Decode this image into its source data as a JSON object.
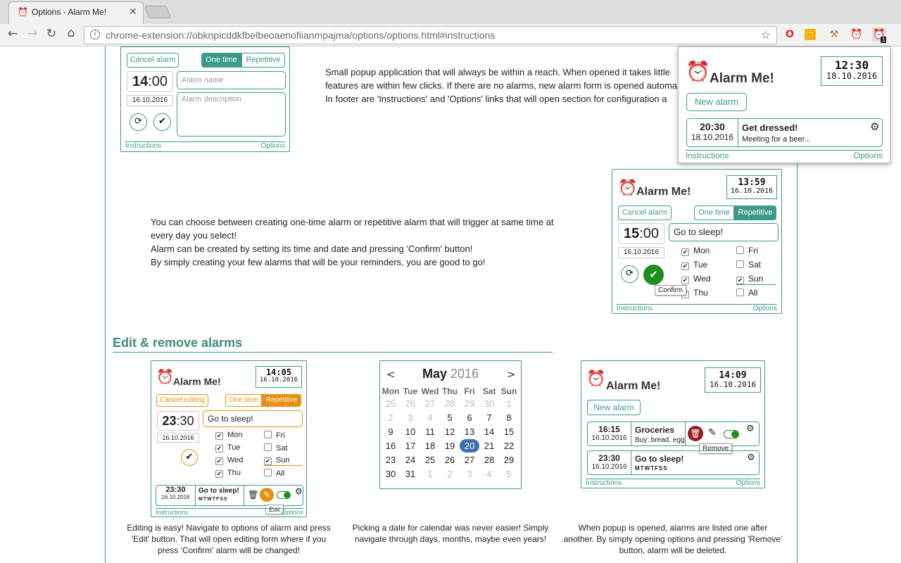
{
  "browser": {
    "tab_title": "Options - Alarm Me!",
    "url": "chrome-extension://obknpicddkfbelbeoaenofiianmpajma/options/options.html#instructions",
    "ext_badge": "1"
  },
  "section1": {
    "text": [
      "Small popup application that will always be within a reach. When opened it takes little",
      "features are within few clicks. If there are no alarms, new alarm form is opened automa",
      "In footer are 'Instructions' and 'Options' links that will open section for configuration a"
    ],
    "demo": {
      "cancel": "Cancel alarm",
      "one_time": "One time",
      "repetitive": "Repetitive",
      "hour": "14",
      "min": ":00",
      "date": "16.10.2016",
      "name_ph": "Alarm name",
      "desc_ph": "Alarm description",
      "instructions": "Instructions",
      "options": "Options"
    }
  },
  "popup": {
    "logo": "Alarm Me!",
    "time": "12:30",
    "date": "18.10.2016",
    "new_alarm": "New alarm",
    "alarm": {
      "time": "20:30",
      "date": "18.10.2016",
      "title": "Get dressed!",
      "desc": "Meeting for a beer..."
    },
    "instructions": "Instructions",
    "options": "Options"
  },
  "section2": {
    "text": [
      "You can choose between creating one-time alarm or repetitive alarm that will trigger at same time at",
      "every day you select!",
      "Alarm can be created by setting its time and date and pressing 'Confirm' button!",
      "By simply creating your few alarms that will be your reminders, you are good to go!"
    ],
    "demo": {
      "logo": "Alarm Me!",
      "time": "13:59",
      "date": "16.10.2016",
      "cancel": "Cancel alarm",
      "one_time": "One time",
      "repetitive": "Repetitive",
      "hour": "15",
      "min": ":00",
      "adate": "16.10.2016",
      "name": "Go to sleep!",
      "days": [
        "Mon",
        "Tue",
        "Wed",
        "Thu",
        "Fri",
        "Sat",
        "Sun",
        "All"
      ],
      "tooltip": "Confirm",
      "instructions": "Instructions",
      "options": "Options"
    }
  },
  "heading": "Edit & remove alarms",
  "edit_demo": {
    "logo": "Alarm Me!",
    "time": "14:05",
    "date": "16.10.2016",
    "cancel": "Cancel editing",
    "one_time": "One time",
    "repetitive": "Repetitive",
    "hour": "23",
    "min": ":30",
    "adate": "16.10.2016",
    "name": "Go to sleep!",
    "days": [
      "Mon",
      "Tue",
      "Wed",
      "Thu",
      "Fri",
      "Sat",
      "Sun",
      "All"
    ],
    "alarm_time": "23:30",
    "alarm_date": "16.10.2016",
    "alarm_title": "Go to sleep!",
    "alarm_days": "MTWTFSS",
    "tooltip": "Edit",
    "instructions": "Instructions",
    "options": "Options",
    "caption": [
      "Editing is easy! Navigate to options of alarm and press",
      "'Edit' button. That will open editing form where if you",
      "press 'Confirm' alarm will be changed!"
    ]
  },
  "calendar": {
    "month": "May",
    "year": "2016",
    "weekdays": [
      "Mon",
      "Tue",
      "Wed",
      "Thu",
      "Fri",
      "Sat",
      "Sun"
    ],
    "rows": [
      [
        "25",
        "26",
        "27",
        "28",
        "29",
        "30",
        "1"
      ],
      [
        "2",
        "3",
        "4",
        "5",
        "6",
        "7",
        "8"
      ],
      [
        "9",
        "10",
        "11",
        "12",
        "13",
        "14",
        "15"
      ],
      [
        "16",
        "17",
        "18",
        "19",
        "20",
        "21",
        "22"
      ],
      [
        "23",
        "24",
        "25",
        "26",
        "27",
        "28",
        "29"
      ],
      [
        "30",
        "31",
        "1",
        "2",
        "3",
        "4",
        "5"
      ]
    ],
    "caption": [
      "Picking a date for calendar was never easier! Simply",
      "navigate through days, months, maybe even years!"
    ]
  },
  "remove_demo": {
    "logo": "Alarm Me!",
    "time": "14:09",
    "date": "16.10.2016",
    "new_alarm": "New alarm",
    "a1": {
      "time": "16:15",
      "date": "16.10.2016",
      "title": "Groceries",
      "desc": "Buy: bread, egg"
    },
    "a2": {
      "time": "23:30",
      "date": "16.10.2016",
      "title": "Go to sleep!",
      "days": "MTWTFSS"
    },
    "tooltip": "Remove",
    "instructions": "Instructions",
    "options": "Options",
    "caption": [
      "When popup is opened, alarms are listed one after",
      "another. By simply opening options and pressing 'Remove'",
      "button, alarm will be deleted."
    ]
  }
}
